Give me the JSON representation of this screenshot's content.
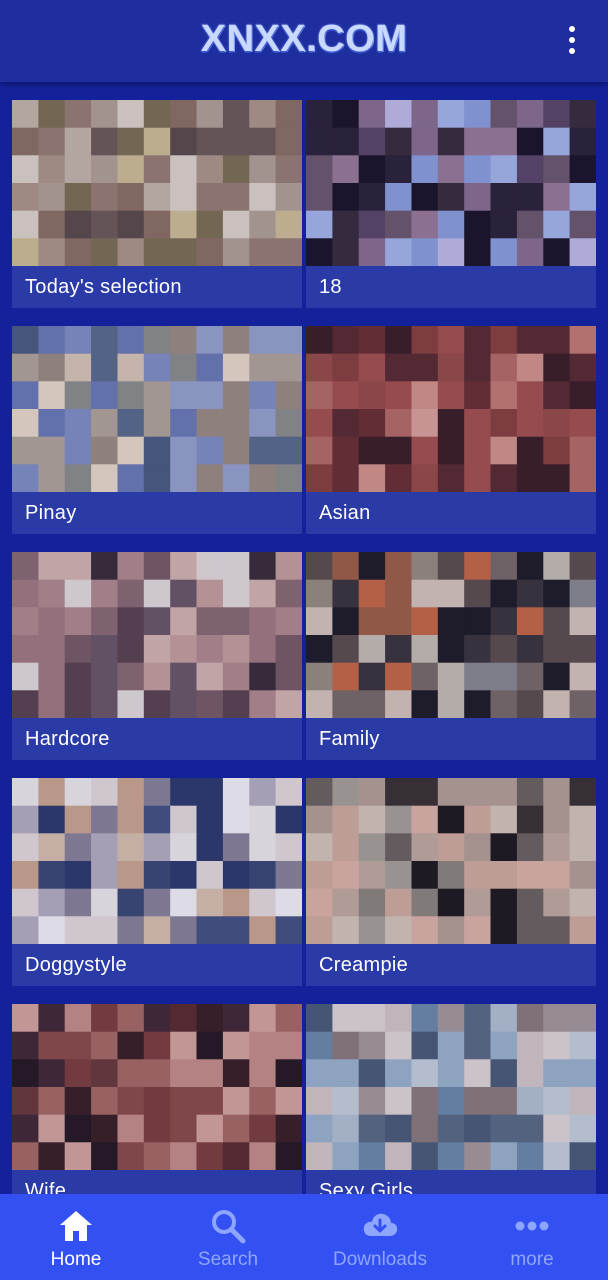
{
  "app": {
    "logo_text": "XNXX.COM"
  },
  "categories": [
    {
      "label": "Today's selection",
      "palette": [
        "#c8b7a3",
        "#b09882",
        "#8e705c",
        "#5d4a43",
        "#d1c08e",
        "#7f6f4c",
        "#b4a28f",
        "#9a7f6c",
        "#e2d6c5",
        "#6e5b50"
      ]
    },
    {
      "label": "18",
      "palette": [
        "#8ca0d8",
        "#a7b8e6",
        "#3a2b35",
        "#1a1320",
        "#6e5866",
        "#9b7a92",
        "#c3bde3",
        "#5a4660",
        "#2c2030",
        "#8a6f8a"
      ]
    },
    {
      "label": "Pinay",
      "palette": [
        "#6b7ab0",
        "#8190bf",
        "#98a3c8",
        "#b4a595",
        "#dcc8b0",
        "#5b6b86",
        "#8f8f86",
        "#4a5c7a",
        "#eddcc3",
        "#9e8d7b"
      ]
    },
    {
      "label": "Asian",
      "palette": [
        "#8a3f36",
        "#a75146",
        "#c77a6a",
        "#d69583",
        "#6b2e2a",
        "#3c1d1e",
        "#b86b5e",
        "#e0a394",
        "#5a2a28",
        "#9a4a40"
      ]
    },
    {
      "label": "Hardcore",
      "palette": [
        "#6c5660",
        "#b48a88",
        "#c9a096",
        "#8c6a6c",
        "#3b2b30",
        "#a47a7c",
        "#d6b6aa",
        "#7a5a5e",
        "#e7ddd8",
        "#5a4248"
      ]
    },
    {
      "label": "Family",
      "palette": [
        "#c8bfae",
        "#9a8c7a",
        "#5e4e46",
        "#3c3434",
        "#a0603e",
        "#c8683e",
        "#7a6a62",
        "#d9c7b6",
        "#1e1a1e",
        "#8a8a8a"
      ]
    },
    {
      "label": "Doggystyle",
      "palette": [
        "#f2ece6",
        "#dcc2a8",
        "#cfa88a",
        "#e7dcd8",
        "#2d3a66",
        "#45527a",
        "#b8b0bc",
        "#8a8292",
        "#f7f4f2",
        "#3b476e"
      ]
    },
    {
      "label": "Creampie",
      "palette": [
        "#a9a292",
        "#8e8676",
        "#b8a190",
        "#3a302a",
        "#1e1816",
        "#d4ad98",
        "#e1b6a2",
        "#c4ab98",
        "#6e6258",
        "#dac7b4"
      ]
    },
    {
      "label": "Wife",
      "palette": [
        "#3a1e1c",
        "#5a2a26",
        "#7e3e36",
        "#a96a5e",
        "#c98f82",
        "#26161a",
        "#8e4c42",
        "#d9a596",
        "#42282c",
        "#6a3a34"
      ]
    },
    {
      "label": "Sexy Girls",
      "palette": [
        "#c8d2d6",
        "#9eb4c6",
        "#d7c9c2",
        "#a89a94",
        "#6e8aa4",
        "#4a5c70",
        "#e4d8d2",
        "#8e7a76",
        "#b4c2cc",
        "#5a6c7e"
      ]
    }
  ],
  "bottom_nav": [
    {
      "label": "Home",
      "icon": "home-icon",
      "active": true
    },
    {
      "label": "Search",
      "icon": "search-icon",
      "active": false
    },
    {
      "label": "Downloads",
      "icon": "download-cloud-icon",
      "active": false
    },
    {
      "label": "more",
      "icon": "more-horizontal-icon",
      "active": false
    }
  ]
}
